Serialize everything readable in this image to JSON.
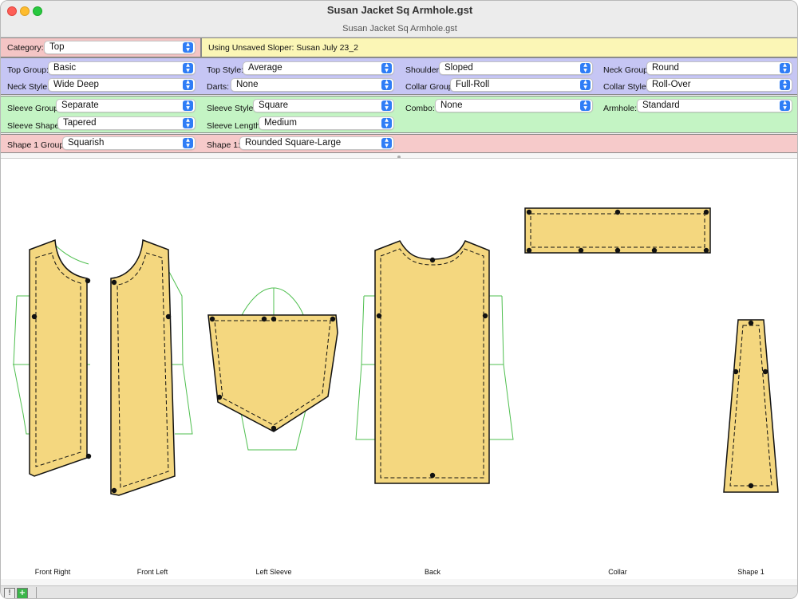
{
  "window": {
    "title": "Susan Jacket Sq Armhole.gst",
    "subtitle": "Susan Jacket Sq Armhole.gst"
  },
  "category": {
    "label": "Category:",
    "value": "Top"
  },
  "sloper": {
    "text": "Using Unsaved Sloper:  Susan July 23_2"
  },
  "top_band": {
    "top_group": {
      "label": "Top Group:",
      "value": "Basic"
    },
    "top_style": {
      "label": "Top Style:",
      "value": "Average"
    },
    "shoulder": {
      "label": "Shoulder:",
      "value": "Sloped"
    },
    "neck_group": {
      "label": "Neck Group:",
      "value": "Round"
    },
    "neck_style": {
      "label": "Neck Style:",
      "value": "Wide Deep"
    },
    "darts": {
      "label": "Darts:",
      "value": "None"
    },
    "collar_group": {
      "label": "Collar Group:",
      "value": "Full-Roll"
    },
    "collar_style": {
      "label": "Collar Style:",
      "value": "Roll-Over"
    }
  },
  "sleeve_band": {
    "sleeve_group": {
      "label": "Sleeve Group:",
      "value": "Separate"
    },
    "sleeve_style": {
      "label": "Sleeve Style:",
      "value": "Square"
    },
    "combo": {
      "label": "Combo:",
      "value": "None"
    },
    "armhole": {
      "label": "Armhole:",
      "value": "Standard"
    },
    "sleeve_shape": {
      "label": "Sleeve Shape:",
      "value": "Tapered"
    },
    "sleeve_length": {
      "label": "Sleeve Length:",
      "value": "Medium"
    }
  },
  "shape_band": {
    "shape1_group": {
      "label": "Shape 1 Group:",
      "value": "Squarish"
    },
    "shape1": {
      "label": "Shape 1:",
      "value": "Rounded Square-Large"
    }
  },
  "pieces": {
    "front_right": "Front Right",
    "front_left": "Front Left",
    "left_sleeve": "Left Sleeve",
    "back": "Back",
    "collar": "Collar",
    "shape1": "Shape 1"
  },
  "colors": {
    "piece_fill": "#f4d77f",
    "guide_green": "#4fbf4f",
    "category_band": "#f4c5c5",
    "sloper_band": "#fbf6b6",
    "top_band": "#c6c6f4",
    "sleeve_band": "#c4f4c4",
    "shape_band": "#f6caca",
    "popup_arrow": "#2f7df6"
  },
  "icons": {
    "status_warn": "warning-icon",
    "status_add": "add-icon"
  }
}
